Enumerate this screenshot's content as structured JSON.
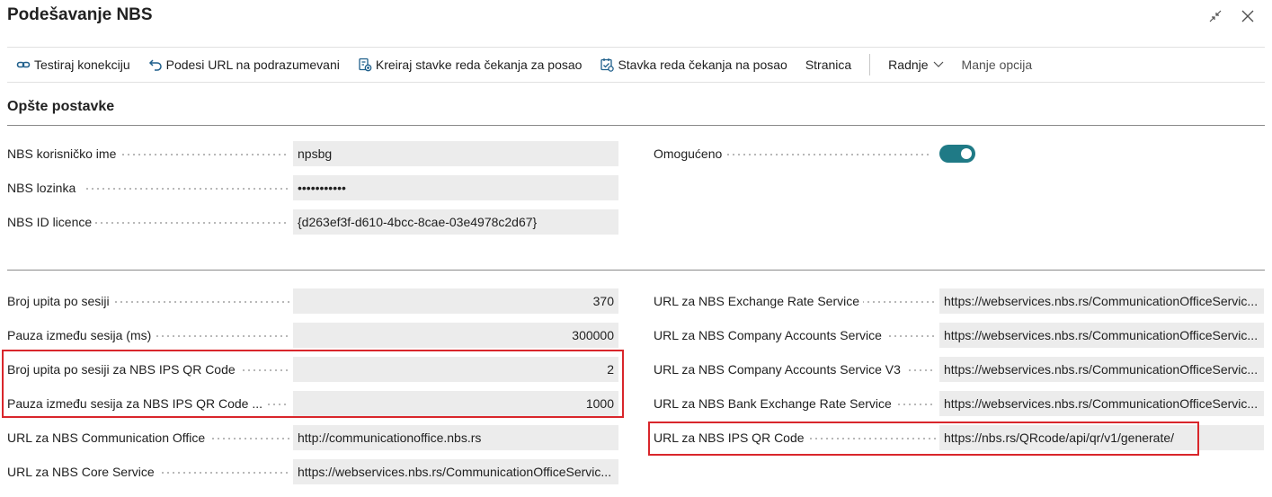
{
  "window": {
    "title": "Podešavanje NBS"
  },
  "toolbar": {
    "actions": [
      {
        "label": "Testiraj konekciju",
        "icon": "link-icon"
      },
      {
        "label": "Podesi URL na podrazumevani",
        "icon": "undo-icon"
      },
      {
        "label": "Kreiraj stavke reda čekanja za posao",
        "icon": "create-queue-icon"
      },
      {
        "label": "Stavka reda čekanja na posao",
        "icon": "queue-item-icon"
      },
      {
        "label": "Stranica"
      }
    ],
    "radnje_label": "Radnje",
    "less_options_label": "Manje opcija"
  },
  "general": {
    "section_title": "Opšte postavke",
    "username_label": "NBS korisničko ime",
    "username_value": "npsbg",
    "password_label": "NBS lozinka",
    "password_value": "•••••••••••",
    "license_label": "NBS ID licence",
    "license_value": "{d263ef3f-d610-4bcc-8cae-03e4978c2d67}",
    "enabled_label": "Omogućeno",
    "enabled": true
  },
  "session": {
    "queries_label": "Broj upita po sesiji",
    "queries_value": "370",
    "pause_label": "Pauza između sesija (ms)",
    "pause_value": "300000",
    "qr_queries_label": "Broj upita po sesiji za NBS IPS QR Code",
    "qr_queries_value": "2",
    "qr_pause_label": "Pauza između sesija za NBS IPS QR Code ...",
    "qr_pause_value": "1000",
    "comm_office_label": "URL za NBS Communication Office",
    "comm_office_value": "http://communicationoffice.nbs.rs",
    "core_service_label": "URL za NBS Core Service",
    "core_service_value": "https://webservices.nbs.rs/CommunicationOfficeServic..."
  },
  "urls": {
    "exchange_rate_label": "URL za NBS Exchange Rate Service",
    "exchange_rate_value": "https://webservices.nbs.rs/CommunicationOfficeServic...",
    "company_accounts_label": "URL za NBS Company Accounts Service",
    "company_accounts_value": "https://webservices.nbs.rs/CommunicationOfficeServic...",
    "company_accounts_v3_label": "URL za NBS Company Accounts Service V3",
    "company_accounts_v3_value": "https://webservices.nbs.rs/CommunicationOfficeServic...",
    "bank_exchange_label": "URL za NBS Bank Exchange Rate Service",
    "bank_exchange_value": "https://webservices.nbs.rs/CommunicationOfficeServic...",
    "ips_qr_label": "URL za NBS IPS QR Code",
    "ips_qr_value": "https://nbs.rs/QRcode/api/qr/v1/generate/"
  },
  "colors": {
    "toggle_on": "#1f7a86",
    "highlight": "#d9262b",
    "field_bg": "#ececec"
  }
}
